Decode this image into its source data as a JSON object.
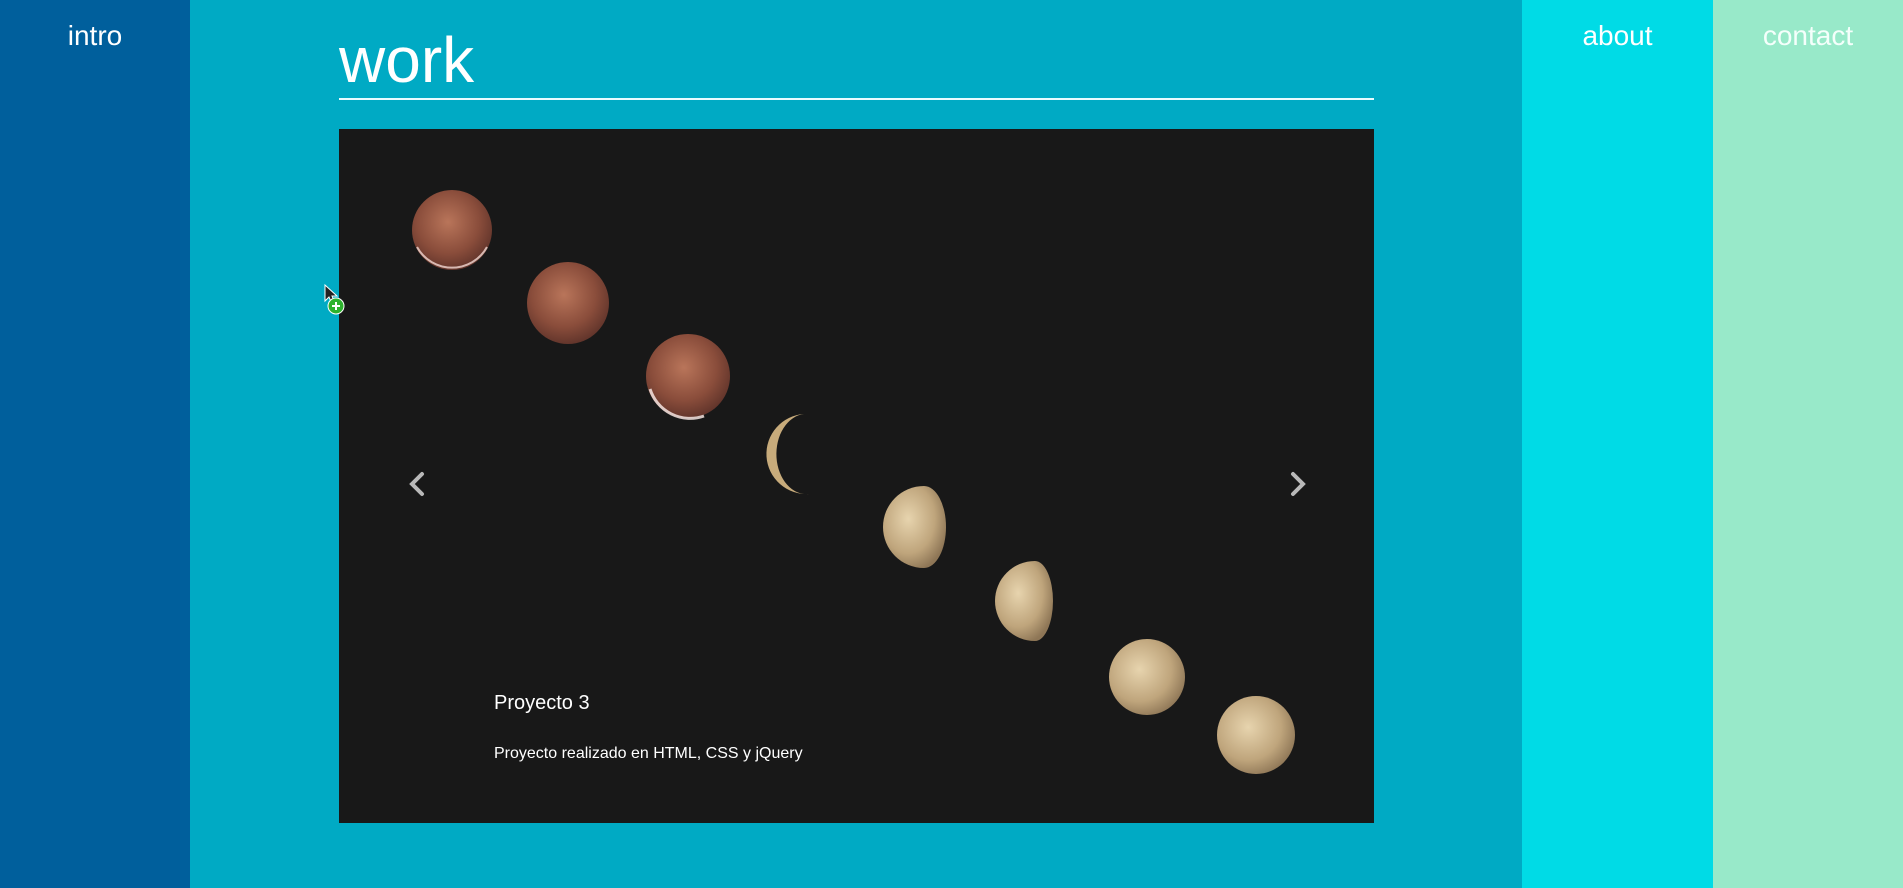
{
  "nav": {
    "intro": "intro",
    "about": "about",
    "contact": "contact"
  },
  "work": {
    "title": "work",
    "slide": {
      "title": "Proyecto 3",
      "description": "Proyecto realizado en HTML, CSS y jQuery",
      "image": "lunar-eclipse-sequence"
    },
    "prev_icon": "chevron-left-icon",
    "next_icon": "chevron-right-icon"
  },
  "colors": {
    "intro_panel": "#005f9c",
    "work_panel": "#00aac4",
    "about_panel": "#00dbe6",
    "contact_panel": "#98e9c9",
    "carousel_bg": "#181818"
  }
}
